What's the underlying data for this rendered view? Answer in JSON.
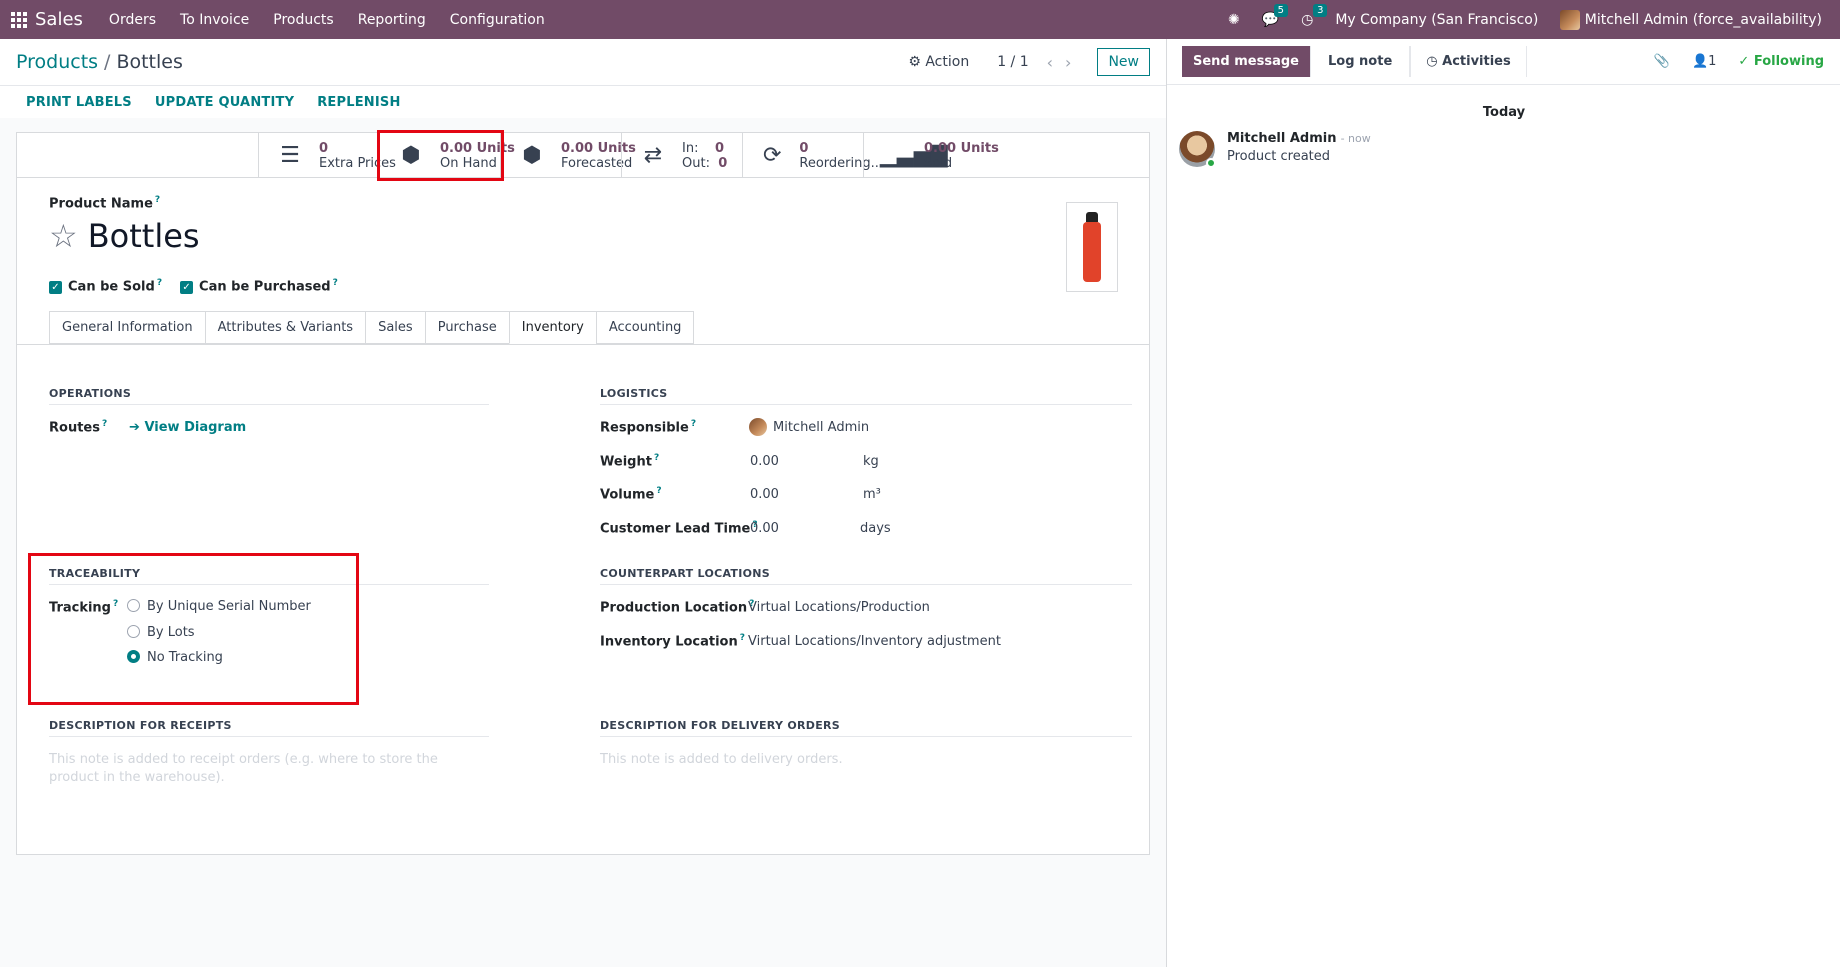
{
  "topbar": {
    "app": "Sales",
    "menu": [
      "Orders",
      "To Invoice",
      "Products",
      "Reporting",
      "Configuration"
    ],
    "messages_count": "5",
    "activities_count": "3",
    "company": "My Company (San Francisco)",
    "user": "Mitchell Admin (force_availability)"
  },
  "breadcrumb": {
    "parent": "Products",
    "sep": "/",
    "current": "Bottles"
  },
  "control": {
    "action": "Action",
    "pager": "1 / 1",
    "new": "New"
  },
  "actions": {
    "print": "PRINT LABELS",
    "update": "UPDATE QUANTITY",
    "replenish": "REPLENISH"
  },
  "stats": {
    "extra_prices": {
      "value": "0",
      "label": "Extra Prices"
    },
    "on_hand": {
      "value": "0.00 Units",
      "label": "On Hand"
    },
    "forecasted": {
      "value": "0.00 Units",
      "label": "Forecasted"
    },
    "inout": {
      "in_label": "In:",
      "in": "0",
      "out_label": "Out:",
      "out": "0"
    },
    "reordering": {
      "value": "0",
      "label": "Reordering..."
    },
    "sold": {
      "value": "0.00 Units",
      "label": "Sold"
    }
  },
  "product": {
    "name_label": "Product Name",
    "name": "Bottles",
    "can_be_sold": "Can be Sold",
    "can_be_purchased": "Can be Purchased",
    "help": "?"
  },
  "tabs": [
    "General Information",
    "Attributes & Variants",
    "Sales",
    "Purchase",
    "Inventory",
    "Accounting"
  ],
  "operations": {
    "title": "OPERATIONS",
    "routes_label": "Routes",
    "view_diagram": "View Diagram"
  },
  "logistics": {
    "title": "LOGISTICS",
    "responsible_label": "Responsible",
    "responsible": "Mitchell Admin",
    "weight_label": "Weight",
    "weight": "0.00",
    "weight_unit": "kg",
    "volume_label": "Volume",
    "volume": "0.00",
    "volume_unit": "m³",
    "lead_label": "Customer Lead Time",
    "lead": "0.00",
    "lead_unit": "days"
  },
  "traceability": {
    "title": "TRACEABILITY",
    "tracking_label": "Tracking",
    "options": [
      "By Unique Serial Number",
      "By Lots",
      "No Tracking"
    ],
    "selected": "No Tracking"
  },
  "counterpart": {
    "title": "COUNTERPART LOCATIONS",
    "production_label": "Production Location",
    "production": "Virtual Locations/Production",
    "inventory_label": "Inventory Location",
    "inventory": "Virtual Locations/Inventory adjustment"
  },
  "desc_receipts": {
    "title": "DESCRIPTION FOR RECEIPTS",
    "placeholder": "This note is added to receipt orders (e.g. where to store the product in the warehouse)."
  },
  "desc_delivery": {
    "title": "DESCRIPTION FOR DELIVERY ORDERS",
    "placeholder": "This note is added to delivery orders."
  },
  "chatter": {
    "send": "Send message",
    "log": "Log note",
    "activities": "Activities",
    "followers": "1",
    "following": "Following",
    "today": "Today",
    "author": "Mitchell Admin",
    "time": "- now",
    "body": "Product created"
  },
  "colors": {
    "brand": "#714b67",
    "accent": "#017e84",
    "highlight": "#e30613"
  }
}
